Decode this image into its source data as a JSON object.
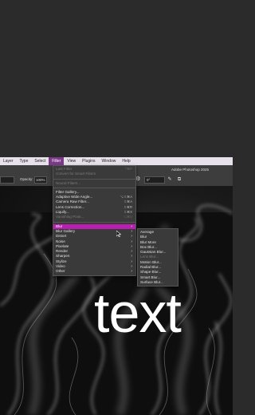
{
  "menubar": {
    "items": [
      "Layer",
      "Type",
      "Select",
      "Filter",
      "View",
      "Plugins",
      "Window",
      "Help"
    ],
    "active_index": 3
  },
  "options_bar": {
    "opacity_label": "Opacity:",
    "opacity_value": "100%",
    "angle_value": "0°",
    "app_title": "Adobe Photoshop 2025"
  },
  "filter_menu": {
    "items": [
      {
        "label": "Last Filter",
        "shortcut": "^⌘F",
        "disabled": true
      },
      {
        "label": "Convert for Smart Filters",
        "shortcut": "",
        "disabled": true
      },
      {
        "sep": true
      },
      {
        "label": "Neural Filters...",
        "shortcut": "",
        "disabled": true
      },
      {
        "sep": true
      },
      {
        "label": "Filter Gallery...",
        "shortcut": "",
        "disabled": false
      },
      {
        "label": "Adaptive Wide Angle...",
        "shortcut": "⌥⇧⌘A",
        "disabled": false
      },
      {
        "label": "Camera Raw Filter...",
        "shortcut": "⇧⌘A",
        "disabled": false
      },
      {
        "label": "Lens Correction...",
        "shortcut": "⇧⌘R",
        "disabled": false
      },
      {
        "label": "Liquify...",
        "shortcut": "⇧⌘X",
        "disabled": false
      },
      {
        "label": "Vanishing Point...",
        "shortcut": "⌥⌘V",
        "disabled": true
      },
      {
        "sep": true
      },
      {
        "label": "Blur",
        "submenu": true,
        "highlighted": true
      },
      {
        "label": "Blur Gallery",
        "submenu": true
      },
      {
        "label": "Distort",
        "submenu": true
      },
      {
        "label": "Noise",
        "submenu": true
      },
      {
        "label": "Pixelate",
        "submenu": true
      },
      {
        "label": "Render",
        "submenu": true
      },
      {
        "label": "Sharpen",
        "submenu": true
      },
      {
        "label": "Stylize",
        "submenu": true
      },
      {
        "label": "Video",
        "submenu": true
      },
      {
        "label": "Other",
        "submenu": true
      }
    ]
  },
  "blur_submenu": {
    "items": [
      {
        "label": "Average",
        "disabled": false
      },
      {
        "label": "Blur",
        "disabled": false
      },
      {
        "label": "Blur More",
        "disabled": false
      },
      {
        "label": "Box Blur...",
        "disabled": false
      },
      {
        "label": "Gaussian Blur...",
        "disabled": false
      },
      {
        "label": "Lens Blur...",
        "disabled": true
      },
      {
        "label": "Motion Blur...",
        "disabled": false
      },
      {
        "label": "Radial Blur...",
        "disabled": false
      },
      {
        "label": "Shape Blur...",
        "disabled": false
      },
      {
        "label": "Smart Blur...",
        "disabled": false
      },
      {
        "label": "Surface Blur...",
        "disabled": false
      }
    ]
  },
  "canvas": {
    "text": "text"
  },
  "icons": {
    "gear": "gear-icon",
    "arrow": "arrow-right-icon",
    "cursor": "cursor-icon"
  }
}
